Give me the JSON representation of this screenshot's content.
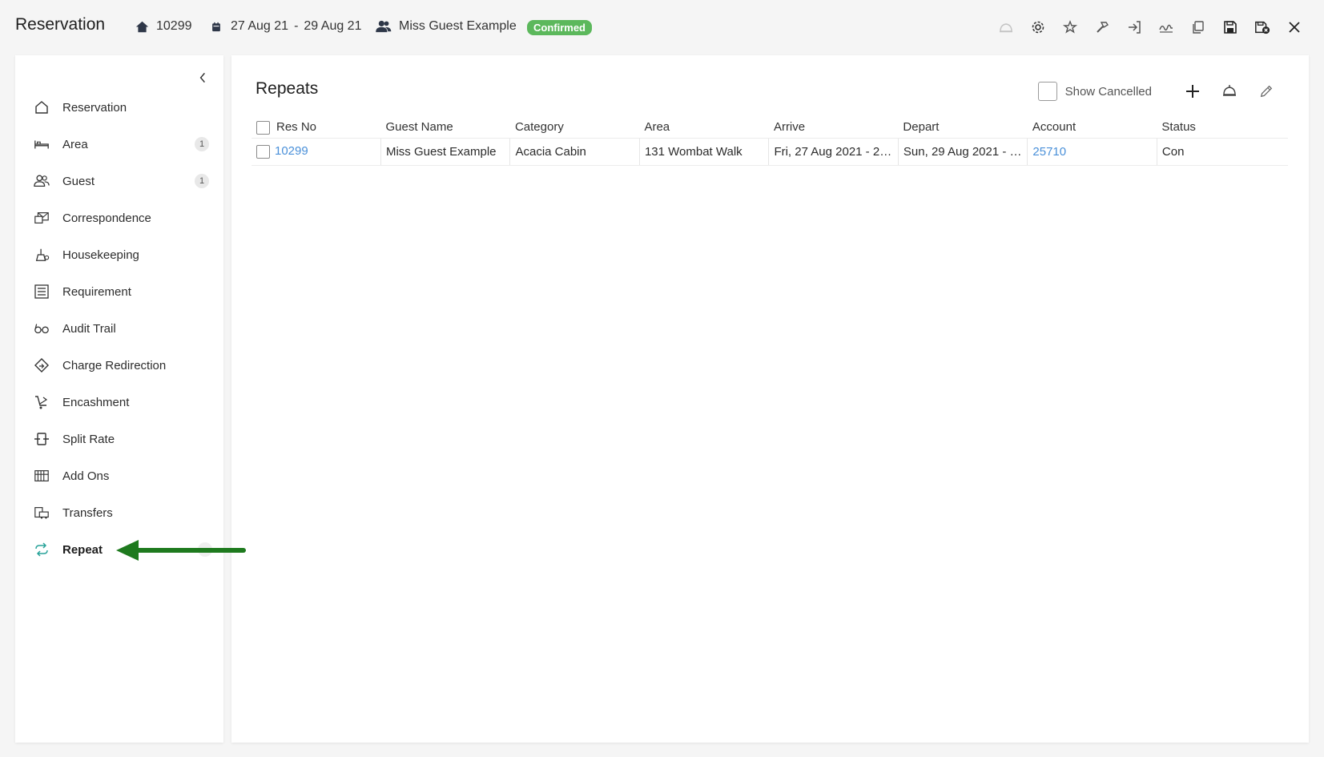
{
  "header": {
    "title": "Reservation",
    "res_no": "10299",
    "date_from": "27 Aug 21",
    "date_sep": "-",
    "date_to": "29 Aug 21",
    "guest_name": "Miss Guest Example",
    "status": "Confirmed",
    "status_color": "#5cb85c",
    "toolbar_icons": [
      "bell-icon",
      "gear-icon",
      "magic-wand-icon",
      "tools-icon",
      "check-in-icon",
      "signature-icon",
      "copy-icon",
      "save-icon",
      "save-close-icon",
      "close-icon"
    ]
  },
  "sidebar": {
    "items": [
      {
        "label": "Reservation",
        "icon": "house-icon",
        "count": ""
      },
      {
        "label": "Area",
        "icon": "bed-icon",
        "count": "1"
      },
      {
        "label": "Guest",
        "icon": "guests-icon",
        "count": "1"
      },
      {
        "label": "Correspondence",
        "icon": "correspondence-icon",
        "count": ""
      },
      {
        "label": "Housekeeping",
        "icon": "housekeeping-icon",
        "count": ""
      },
      {
        "label": "Requirement",
        "icon": "requirement-icon",
        "count": ""
      },
      {
        "label": "Audit Trail",
        "icon": "glasses-icon",
        "count": ""
      },
      {
        "label": "Charge Redirection",
        "icon": "redirect-icon",
        "count": ""
      },
      {
        "label": "Encashment",
        "icon": "cart-icon",
        "count": ""
      },
      {
        "label": "Split Rate",
        "icon": "split-rate-icon",
        "count": ""
      },
      {
        "label": "Add Ons",
        "icon": "add-ons-icon",
        "count": ""
      },
      {
        "label": "Transfers",
        "icon": "transfers-icon",
        "count": ""
      },
      {
        "label": "Repeat",
        "icon": "repeat-icon",
        "count": ""
      }
    ],
    "active": "Repeat"
  },
  "main": {
    "title": "Repeats",
    "show_cancelled_label": "Show Cancelled",
    "columns": [
      "Res No",
      "Guest Name",
      "Category",
      "Area",
      "Arrive",
      "Depart",
      "Account",
      "Status"
    ],
    "rows": [
      {
        "res_no": "10299",
        "guest_name": "Miss Guest Example",
        "category": "Acacia Cabin",
        "area": "131 Wombat Walk",
        "arrive": "Fri, 27 Aug 2021 - 2:0...",
        "depart": "Sun, 29 Aug 2021 - 1...",
        "account": "25710",
        "status": "Con"
      }
    ]
  },
  "annotation": {
    "color": "#1e7a1e"
  }
}
